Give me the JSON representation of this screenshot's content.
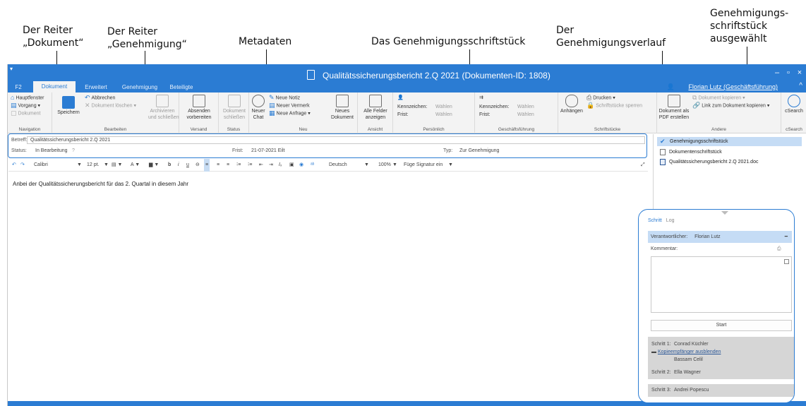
{
  "annotations": {
    "tab_document": "Der Reiter\n„Dokument“",
    "tab_approval": "Der Reiter\n„Genehmigung“",
    "metadata": "Metadaten",
    "approval_document": "Das Genehmigungsschriftstück",
    "approval_history": "Der\nGenehmigungsverlauf",
    "approval_doc_selected": "Genehmigungs-\nschriftstück\nausgewählt"
  },
  "window": {
    "title": "Qualitätssicherungsbericht 2.Q 2021 (Dokumenten-ID: 1808)",
    "user": "Florian Lutz (Geschäftsführung)",
    "tabs": [
      "F2",
      "Dokument",
      "Erweitert",
      "Genehmigung",
      "Beteiligte"
    ],
    "active_tab": "Dokument"
  },
  "ribbon": {
    "navigation": {
      "label": "Navigation",
      "items": [
        "Hauptfenster",
        "Vorgang",
        "Dokument"
      ]
    },
    "bearbeiten": {
      "label": "Bearbeiten",
      "save": "Speichern",
      "cancel": "Abbrechen",
      "delete": "Dokument löschen",
      "archive": "Archivieren\nund schließen"
    },
    "versand": {
      "label": "Versand",
      "send": "Absenden\nvorbereiten"
    },
    "status": {
      "label": "Status",
      "close": "Dokument\nschließen"
    },
    "neu": {
      "label": "Neu",
      "chat": "Neuer\nChat",
      "note": "Neue Notiz",
      "remark": "Neuer Vermerk",
      "request": "Neue Anfrage",
      "newdoc": "Neues\nDokument"
    },
    "ansicht": {
      "label": "Ansicht",
      "fields": "Alle Felder\nanzeigen"
    },
    "persoenlich": {
      "label": "Persönlich",
      "kennzeichen": "Kennzeichen:",
      "frist": "Frist:",
      "choose": "Wählen"
    },
    "gf": {
      "label": "Geschäftsführung",
      "kennzeichen": "Kennzeichen:",
      "frist": "Frist:",
      "choose": "Wählen"
    },
    "schriftstuecke": {
      "label": "Schriftstücke",
      "attach": "Anhängen",
      "print": "Drucken",
      "lock": "Schriftstücke sperren"
    },
    "andere": {
      "label": "Andere",
      "pdf": "Dokument als\nPDF erstellen",
      "copy_doc": "Dokument kopieren",
      "copy_link": "Link zum Dokument kopieren"
    },
    "csearch": {
      "label": "cSearch",
      "button": "cSearch"
    }
  },
  "meta": {
    "subject_label": "Betreff:",
    "subject": "Qualitätssicherungsbericht 2.Q 2021",
    "status_label": "Status:",
    "status": "In Bearbeitung",
    "deadline_label": "Frist:",
    "deadline": "21-07-2021 Eilt",
    "type_label": "Typ:",
    "type": "Zur Genehmigung"
  },
  "editor": {
    "font": "Calibri",
    "size": "12 pt.",
    "language": "Deutsch",
    "zoom": "100%",
    "signature": "Füge Signatur ein",
    "body": "Anbei der Qualitätssicherungsbericht für das 2. Quartal in diesem Jahr"
  },
  "documents": [
    {
      "name": "Genehmigungsschriftstück",
      "selected": true,
      "icon": "check-icon"
    },
    {
      "name": "Dokumentenschriftstück",
      "selected": false,
      "icon": "page-icon"
    },
    {
      "name": "Qualitätssicherungsbericht 2.Q 2021.doc",
      "selected": false,
      "icon": "word-icon"
    }
  ],
  "workflow": {
    "tab_step": "Schritt",
    "tab_log": "Log",
    "responsible_label": "Verantwortlicher:",
    "responsible": "Florian Lutz",
    "comment_label": "Kommentar:",
    "start": "Start",
    "steps": [
      {
        "label": "Schritt 1:",
        "name": "Conrad Küchler",
        "cc_link": "Kopieempfänger ausblenden",
        "cc": "Bassam Celil"
      },
      {
        "label": "Schritt 2:",
        "name": "Ella Wagner"
      },
      {
        "label": "Schritt 3:",
        "name": "Andrei Popescu"
      }
    ]
  },
  "colors": {
    "accent": "#2b7cd3",
    "selection": "#c5dcf5",
    "step_bg": "#d6d6d6"
  }
}
